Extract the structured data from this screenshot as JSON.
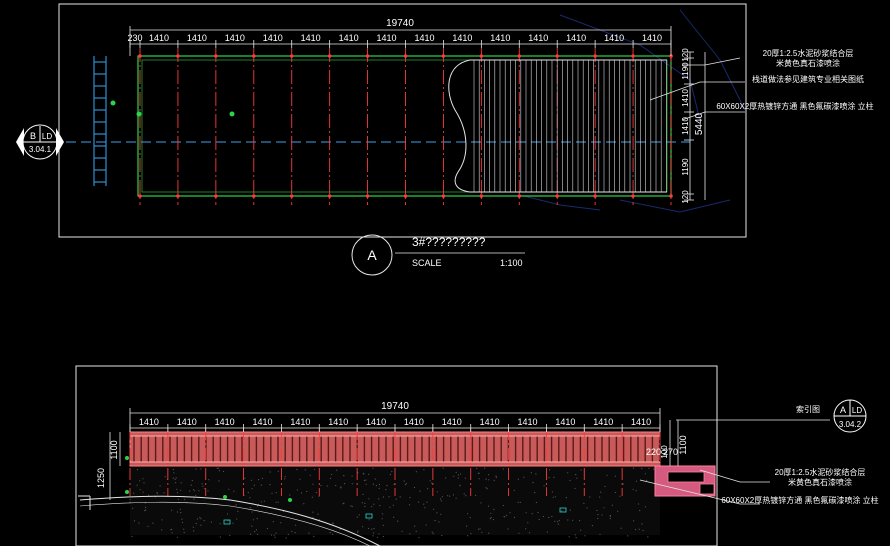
{
  "plan": {
    "total_dim": "19740",
    "top_dims": [
      "230",
      "1410",
      "1410",
      "1410",
      "1410",
      "1410",
      "1410",
      "1410",
      "1410",
      "1410",
      "1410",
      "1410",
      "1410",
      "1410",
      "1410"
    ],
    "right_dims": [
      "120",
      "1190",
      "1410",
      "1410",
      "1190",
      "120"
    ],
    "overall_side_dim": "5440",
    "section_marker": {
      "letter": "B",
      "sheet": "LD",
      "code": "3.04.1"
    },
    "title_marker": {
      "letter": "A"
    },
    "title": "3#?????????",
    "scale_label": "SCALE",
    "scale_value": "1:100",
    "annotations": [
      {
        "line1": "20厚1:2.5水泥砂浆结合层",
        "line2": "米黄色真石漆喷涂"
      },
      {
        "line1": "栈道做法参见建筑专业相关图纸",
        "line2": ""
      },
      {
        "line1": "60X60X2厚热镀锌方通 黑色氟碳漆喷涂 立柱",
        "line2": ""
      }
    ],
    "tree_labels": [
      "",
      "",
      ""
    ]
  },
  "elevation": {
    "total_dim": "19740",
    "top_dims": [
      "1410",
      "1410",
      "1410",
      "1410",
      "1410",
      "1410",
      "1410",
      "1410",
      "1410",
      "1410",
      "1410",
      "1410",
      "1410",
      "1410"
    ],
    "left_dims": [
      "1250",
      "1100"
    ],
    "right_dims": [
      "100",
      "1100"
    ],
    "small_dims": [
      "220",
      "270"
    ],
    "ref_label": "索引图",
    "section_marker": {
      "letter": "A",
      "sheet": "LD",
      "code": "3.04.2"
    },
    "annotations": [
      {
        "line1": "20厚1:2.5水泥砂浆结合层",
        "line2": "米黄色真石漆喷涂"
      },
      {
        "line1": "60X60X2厚热镀锌方通 黑色氟碳漆喷涂 立柱",
        "line2": ""
      }
    ]
  }
}
